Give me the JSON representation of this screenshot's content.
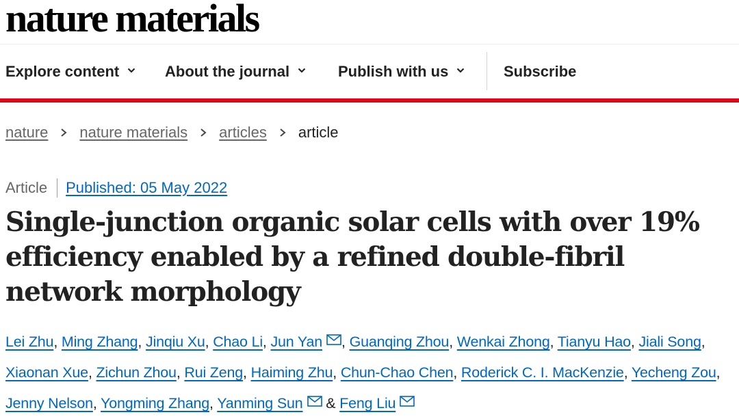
{
  "header": {
    "logo_text": "nature materials"
  },
  "nav": {
    "items": [
      {
        "label": "Explore content",
        "icon": "chevron-down-icon"
      },
      {
        "label": "About the journal",
        "icon": "chevron-down-icon"
      },
      {
        "label": "Publish with us",
        "icon": "chevron-down-icon"
      },
      {
        "label": "Subscribe"
      }
    ]
  },
  "breadcrumb": {
    "items": [
      "nature",
      "nature materials",
      "articles"
    ],
    "current": "article"
  },
  "article": {
    "type": "Article",
    "published": "Published: 05 May 2022",
    "title": "Single-junction organic solar cells with over 19% efficiency enabled by a refined double-fibril network morphology",
    "authors": [
      {
        "name": "Lei Zhu"
      },
      {
        "name": "Ming Zhang"
      },
      {
        "name": "Jinqiu Xu"
      },
      {
        "name": "Chao Li"
      },
      {
        "name": "Jun Yan",
        "mail": true
      },
      {
        "name": "Guanqing Zhou"
      },
      {
        "name": "Wenkai Zhong"
      },
      {
        "name": "Tianyu Hao"
      },
      {
        "name": "Jiali Song"
      },
      {
        "name": "Xiaonan Xue"
      },
      {
        "name": "Zichun Zhou"
      },
      {
        "name": "Rui Zeng"
      },
      {
        "name": "Haiming Zhu"
      },
      {
        "name": "Chun-Chao Chen"
      },
      {
        "name": "Roderick C. I. MacKenzie"
      },
      {
        "name": "Yecheng Zou"
      },
      {
        "name": "Jenny Nelson"
      },
      {
        "name": "Yongming Zhang"
      },
      {
        "name": "Yanming Sun",
        "mail": true
      },
      {
        "name": "Feng Liu",
        "mail": true
      }
    ],
    "author_separator": ",",
    "last_separator": "&",
    "mail_icon": "mail-icon"
  },
  "colors": {
    "accent_red": "#e0071b",
    "link_blue": "#0067c5",
    "text": "#222222",
    "muted": "#666666"
  }
}
